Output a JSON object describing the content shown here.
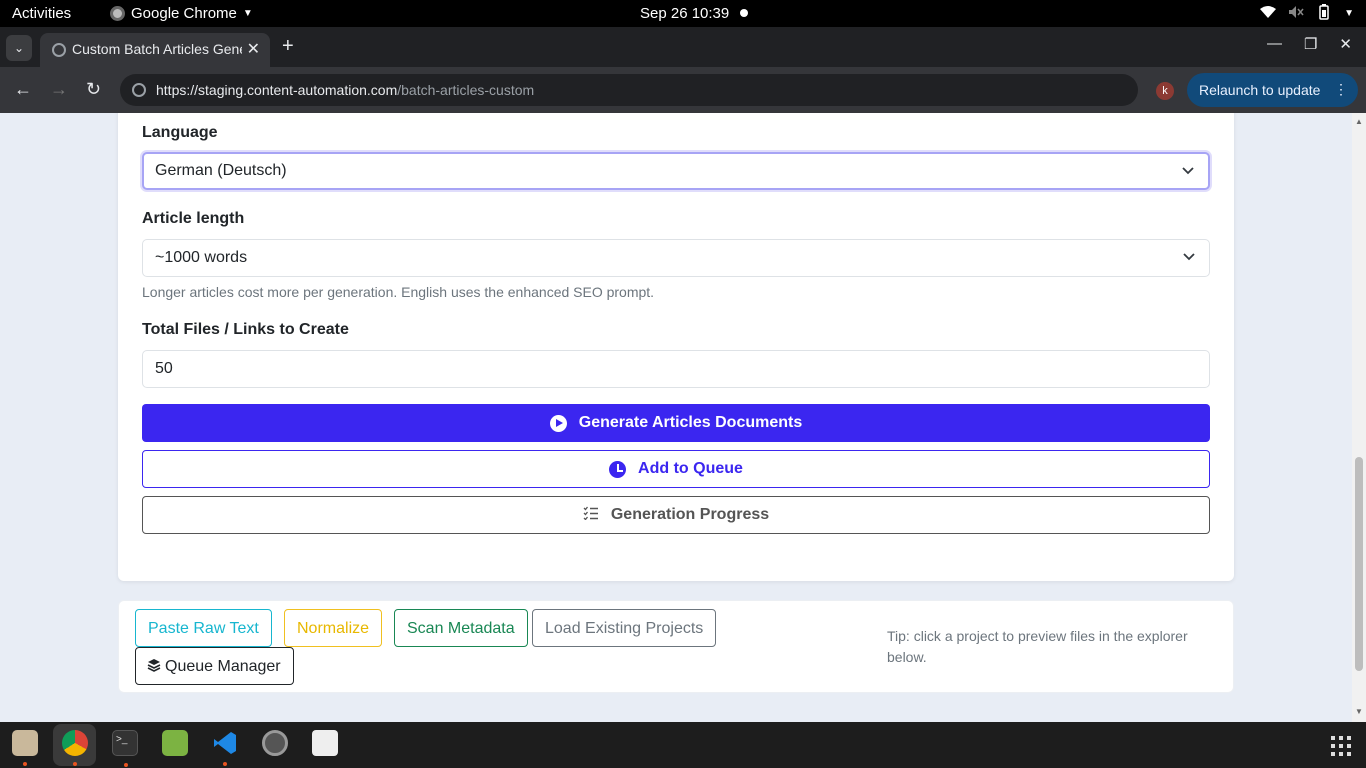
{
  "system": {
    "activities": "Activities",
    "app_name": "Google Chrome",
    "clock": "Sep 26  10:39"
  },
  "browser": {
    "tab_title": "Custom Batch Articles Generator",
    "url_host": "https://staging.content-automation.com",
    "url_path": "/batch-articles-custom",
    "profile_initial": "k",
    "relaunch_label": "Relaunch to update"
  },
  "form": {
    "language_label": "Language",
    "language_value": "German (Deutsch)",
    "length_label": "Article length",
    "length_value": "~1000 words",
    "length_help": "Longer articles cost more per generation. English uses the enhanced SEO prompt.",
    "total_label": "Total Files / Links to Create",
    "total_value": "50",
    "generate_label": "Generate Articles Documents",
    "queue_label": "Add to Queue",
    "progress_label": "Generation Progress"
  },
  "actions": {
    "paste_label": "Paste Raw Text",
    "normalize_label": "Normalize",
    "scan_label": "Scan Metadata",
    "load_label": "Load Existing Projects",
    "queue_manager_label": "Queue Manager",
    "tip": "Tip: click a project to preview files in the explorer below."
  },
  "colors": {
    "primary": "#3b26f0",
    "cyan": "#17b6cf",
    "yellow": "#f0c020",
    "green": "#198754"
  }
}
